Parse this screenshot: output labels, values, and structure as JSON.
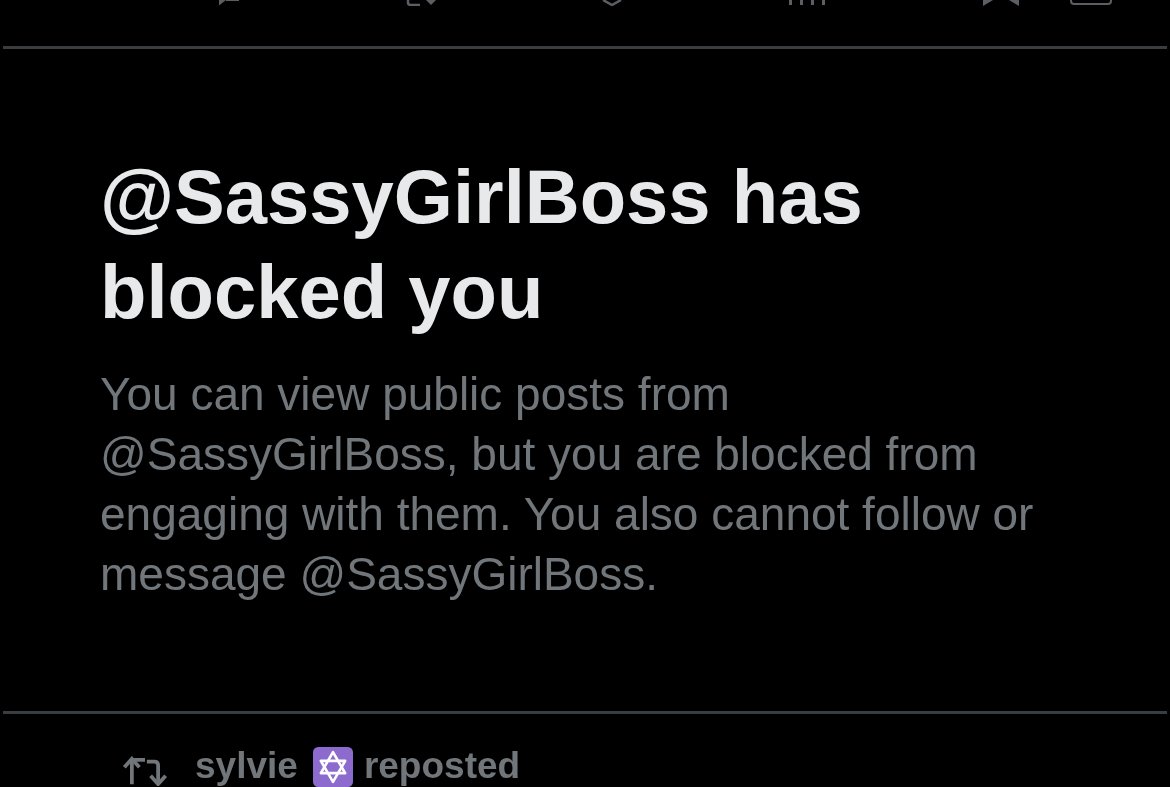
{
  "blocked_notice": {
    "title": "@SassyGirlBoss has blocked you",
    "message": "You can view public posts from @SassyGirlBoss, but you are blocked from engaging with them. You also cannot follow or message @SassyGirlBoss."
  },
  "next_post": {
    "reposted_by": "sylvie",
    "label": "reposted"
  }
}
